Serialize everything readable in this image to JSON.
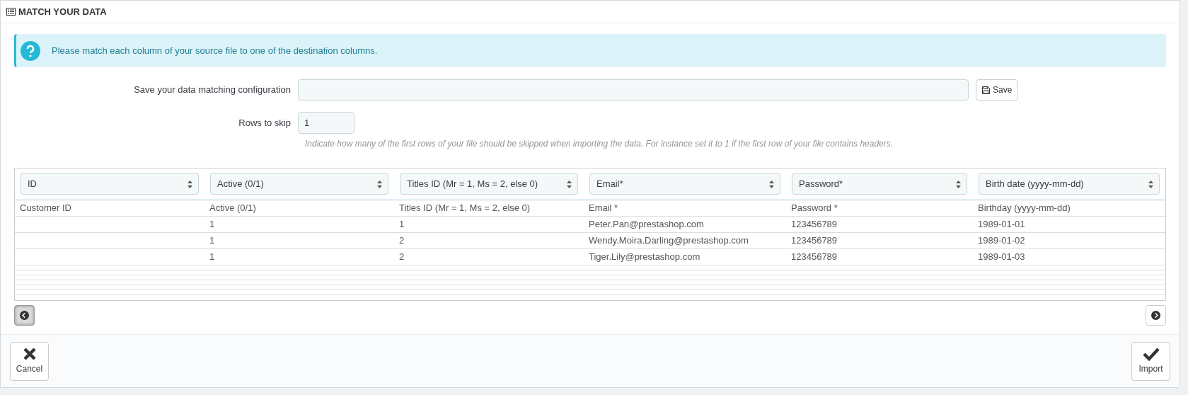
{
  "panel": {
    "title": "MATCH YOUR DATA"
  },
  "alert": {
    "text": "Please match each column of your source file to one of the destination columns."
  },
  "config": {
    "label": "Save your data matching configuration",
    "button": "Save"
  },
  "skip": {
    "label": "Rows to skip",
    "value": "1",
    "help": "Indicate how many of the first rows of your file should be skipped when importing the data. For instance set it to 1 if the first row of your file contains headers."
  },
  "table": {
    "selects": [
      "ID",
      "Active (0/1)",
      "Titles ID (Mr = 1, Ms = 2, else 0)",
      "Email*",
      "Password*",
      "Birth date (yyyy-mm-dd)"
    ],
    "columns": [
      "Customer ID",
      "Active (0/1)",
      "Titles ID (Mr = 1, Ms = 2, else 0)",
      "Email *",
      "Password *",
      "Birthday (yyyy-mm-dd)"
    ],
    "rows": [
      [
        "",
        "1",
        "1",
        "Peter.Pan@prestashop.com",
        "123456789",
        "1989-01-01"
      ],
      [
        "",
        "1",
        "2",
        "Wendy.Moira.Darling@prestashop.com",
        "123456789",
        "1989-01-02"
      ],
      [
        "",
        "1",
        "2",
        "Tiger.Lily@prestashop.com",
        "123456789",
        "1989-01-03"
      ]
    ]
  },
  "pager": [
    {
      "kind": "prev",
      "pressed": true
    },
    {
      "kind": "next",
      "pressed": false
    }
  ],
  "footer": {
    "cancel": "Cancel",
    "import": "Import"
  }
}
